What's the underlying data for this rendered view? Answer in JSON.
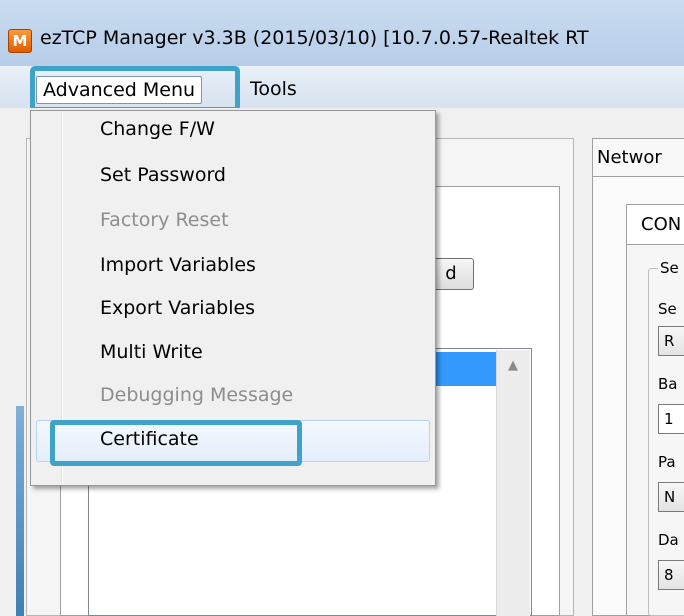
{
  "window": {
    "icon_letter": "M",
    "title": "ezTCP Manager v3.3B (2015/03/10) [10.7.0.57-Realtek RT"
  },
  "menubar": {
    "advanced_menu": "Advanced Menu",
    "tools": "Tools"
  },
  "advanced_menu_items": [
    {
      "label": "Change F/W",
      "enabled": true
    },
    {
      "label": "Set Password",
      "enabled": true
    },
    {
      "label": "Factory Reset",
      "enabled": false
    },
    {
      "label": "Import Variables",
      "enabled": true
    },
    {
      "label": "Export Variables",
      "enabled": true
    },
    {
      "label": "Multi Write",
      "enabled": true
    },
    {
      "label": "Debugging Message",
      "enabled": false
    },
    {
      "label": "Certificate",
      "enabled": true
    }
  ],
  "background": {
    "partial_button_text": "d",
    "network_tab": "Networ",
    "con_tab": "CON",
    "group_title": "Se",
    "fields": [
      {
        "label": "Se",
        "value": "R"
      },
      {
        "label": "Ba",
        "value": "1"
      },
      {
        "label": "Pa",
        "value": "N"
      },
      {
        "label": "Da",
        "value": "8"
      }
    ]
  },
  "colors": {
    "highlight_border": "#3fa2c8",
    "list_selection": "#3399ff"
  }
}
